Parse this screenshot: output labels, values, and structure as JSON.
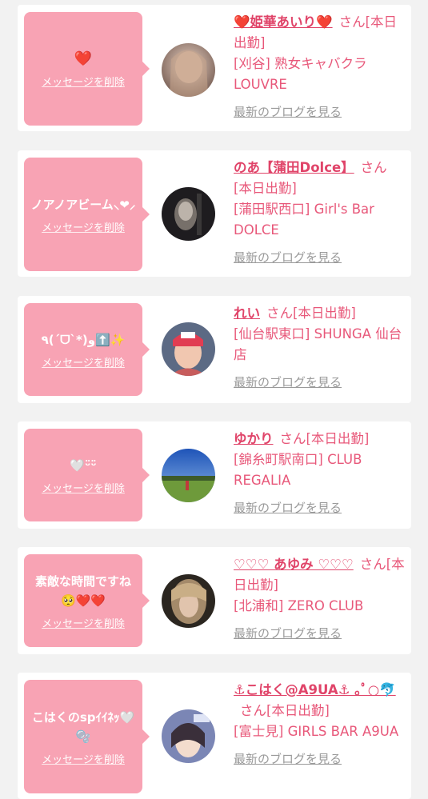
{
  "cards": [
    {
      "message": "❤️",
      "delete_label": "メッセージを削除",
      "name": "❤️姫華あいり❤️",
      "honorific": "さん[本日出勤]",
      "shop": "[刈谷] 熟女キャバクラ LOUVRE",
      "blog_label": "最新のブログを見る"
    },
    {
      "message": "ノアノアビーム⸜❤︎⸝",
      "delete_label": "メッセージを削除",
      "name": "のあ【蒲田Dolce】",
      "honorific": "さん[本日出勤]",
      "shop": "[蒲田駅西口] Girl's Bar DOLCE",
      "blog_label": "最新のブログを見る"
    },
    {
      "message": "٩(ˊᗜˋ*)و⬆️✨",
      "delete_label": "メッセージを削除",
      "name": "れい",
      "honorific": "さん[本日出勤]",
      "shop": "[仙台駅東口] SHUNGA 仙台店",
      "blog_label": "最新のブログを見る"
    },
    {
      "message": "🤍ᵕ̈ᵕ̈",
      "delete_label": "メッセージを削除",
      "name": "ゆかり",
      "honorific": "さん[本日出勤]",
      "shop": "[錦糸町駅南口] CLUB REGALIA",
      "blog_label": "最新のブログを見る"
    },
    {
      "message": "素敵な時間ですね🥺❤️❤️",
      "delete_label": "メッセージを削除",
      "name": "♡♡♡ あゆみ ♡♡♡",
      "honorific": "さん[本日出勤]",
      "shop": "[北浦和] ZERO CLUB",
      "blog_label": "最新のブログを見る"
    },
    {
      "message": "こはくのspｲｲﾈｯ🤍🫧",
      "delete_label": "メッセージを削除",
      "name": "⚓︎こはく@A9UA⚓︎ ｡ﾟ○🐬",
      "honorific": "さん[本日出勤]",
      "shop": "[富士見] GIRLS BAR A9UA",
      "blog_label": "最新のブログを見る"
    }
  ]
}
